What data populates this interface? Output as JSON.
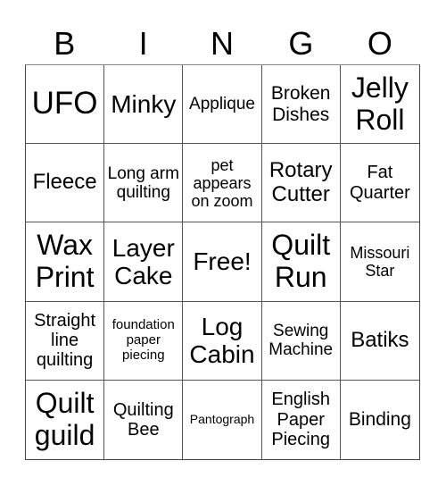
{
  "header": [
    "B",
    "I",
    "N",
    "G",
    "O"
  ],
  "cells": [
    {
      "text": "UFO",
      "size": "s36"
    },
    {
      "text": "Minky",
      "size": "s28"
    },
    {
      "text": "Applique",
      "size": "s19"
    },
    {
      "text": "Broken Dishes",
      "size": "s21"
    },
    {
      "text": "Jelly Roll",
      "size": "s32"
    },
    {
      "text": "Fleece",
      "size": "s24"
    },
    {
      "text": "Long arm quilting",
      "size": "s19"
    },
    {
      "text": "pet appears on zoom",
      "size": "s18"
    },
    {
      "text": "Rotary Cutter",
      "size": "s24"
    },
    {
      "text": "Fat Quarter",
      "size": "s20"
    },
    {
      "text": "Wax Print",
      "size": "s32"
    },
    {
      "text": "Layer Cake",
      "size": "s28"
    },
    {
      "text": "Free!",
      "size": "s28"
    },
    {
      "text": "Quilt Run",
      "size": "s32"
    },
    {
      "text": "Missouri Star",
      "size": "s18"
    },
    {
      "text": "Straight line quilting",
      "size": "s20"
    },
    {
      "text": "foundation paper piecing",
      "size": "s15"
    },
    {
      "text": "Log Cabin",
      "size": "s28"
    },
    {
      "text": "Sewing Machine",
      "size": "s19"
    },
    {
      "text": "Batiks",
      "size": "s24"
    },
    {
      "text": "Quilt guild",
      "size": "s32"
    },
    {
      "text": "Quilting Bee",
      "size": "s20"
    },
    {
      "text": "Pantograph",
      "size": "s14"
    },
    {
      "text": "English Paper Piecing",
      "size": "s20"
    },
    {
      "text": "Binding",
      "size": "s21"
    }
  ]
}
